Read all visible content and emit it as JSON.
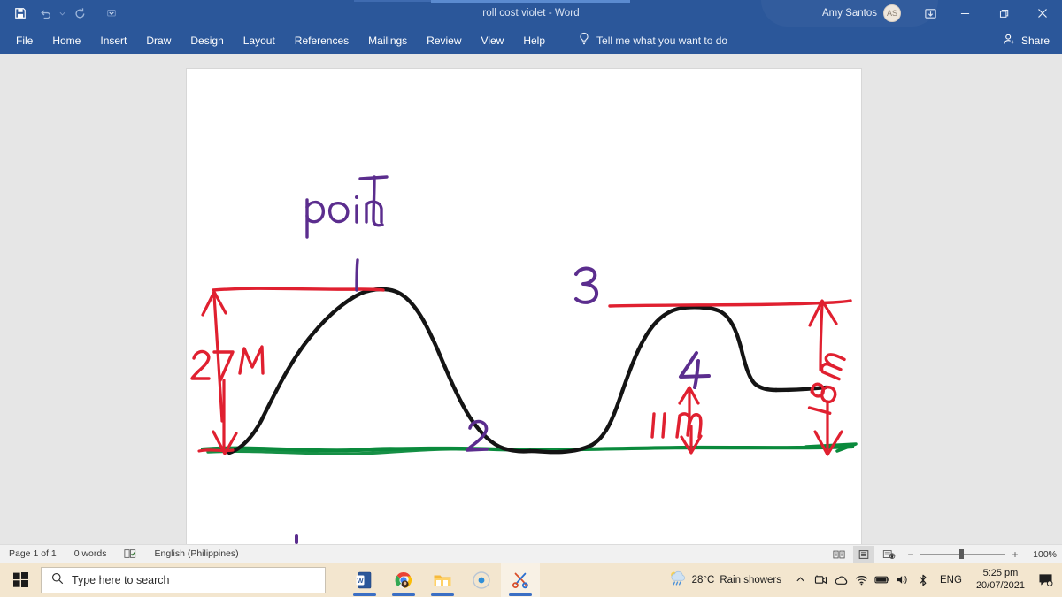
{
  "window": {
    "title": "roll cost violet  -  Word",
    "account_name": "Amy Santos",
    "account_initials": "AS",
    "quick_access": [
      {
        "name": "save-icon",
        "label": "Save"
      },
      {
        "name": "undo-icon",
        "label": "Undo"
      },
      {
        "name": "redo-icon",
        "label": "Redo"
      },
      {
        "name": "customize-quick-access-icon",
        "label": "Customize Quick Access Toolbar"
      }
    ],
    "controls": [
      {
        "name": "ribbon-display-options-button",
        "label": "Ribbon Display Options"
      },
      {
        "name": "minimize-button",
        "label": "Minimize",
        "glyph": "—"
      },
      {
        "name": "restore-button",
        "label": "Restore Down",
        "glyph": "❐"
      },
      {
        "name": "close-button",
        "label": "Close",
        "glyph": "✕"
      }
    ],
    "accent_color": "#2b579a"
  },
  "ribbon": {
    "tabs": [
      {
        "label": "File"
      },
      {
        "label": "Home"
      },
      {
        "label": "Insert"
      },
      {
        "label": "Draw"
      },
      {
        "label": "Design"
      },
      {
        "label": "Layout"
      },
      {
        "label": "References"
      },
      {
        "label": "Mailings"
      },
      {
        "label": "Review"
      },
      {
        "label": "View"
      },
      {
        "label": "Help"
      }
    ],
    "tell_me": "Tell me what you want to do",
    "share_label": "Share"
  },
  "document": {
    "page_background": "#ffffff",
    "ink_colors": {
      "black": "#141414",
      "red": "#e02030",
      "green": "#0a8a3c",
      "purple": "#5b2d8e"
    },
    "annotations": [
      {
        "name": "ink-label-point",
        "text": "point",
        "color": "purple"
      },
      {
        "name": "ink-label-1",
        "text": "1",
        "color": "purple"
      },
      {
        "name": "ink-label-2",
        "text": "2",
        "color": "purple"
      },
      {
        "name": "ink-label-3",
        "text": "3",
        "color": "purple"
      },
      {
        "name": "ink-label-4",
        "text": "4",
        "color": "purple"
      },
      {
        "name": "ink-dimension-27m",
        "text": "27 M",
        "color": "red"
      },
      {
        "name": "ink-dimension-11m",
        "text": "11 m",
        "color": "red"
      },
      {
        "name": "ink-dimension-18m",
        "text": "18 m",
        "color": "red"
      }
    ]
  },
  "status_bar": {
    "page_info": "Page 1 of 1",
    "word_count": "0 words",
    "proofing_icon": "proofing-errors-icon",
    "language": "English (Philippines)",
    "views": [
      {
        "name": "read-mode-view-button",
        "label": "Read Mode",
        "active": false
      },
      {
        "name": "print-layout-view-button",
        "label": "Print Layout",
        "active": true
      },
      {
        "name": "web-layout-view-button",
        "label": "Web Layout",
        "active": false
      }
    ],
    "zoom_out_label": "−",
    "zoom_in_label": "+",
    "zoom_level": "100%"
  },
  "taskbar": {
    "start_label": "Start",
    "search_placeholder": "Type here to search",
    "apps": [
      {
        "name": "taskbar-word-icon",
        "label": "Word",
        "running": true
      },
      {
        "name": "taskbar-chrome-icon",
        "label": "Google Chrome",
        "running": true
      },
      {
        "name": "taskbar-file-explorer-icon",
        "label": "File Explorer",
        "running": true
      },
      {
        "name": "taskbar-media-icon",
        "label": "Media Player",
        "running": false
      },
      {
        "name": "taskbar-snip-sketch-icon",
        "label": "Snip & Sketch",
        "running": true
      }
    ],
    "weather": {
      "temperature": "28°C",
      "condition": "Rain showers",
      "icon": "rain-showers-icon"
    },
    "tray_icons": [
      {
        "name": "show-hidden-icons-chevron-icon",
        "label": "Show hidden icons"
      },
      {
        "name": "webcam-icon",
        "label": "Camera"
      },
      {
        "name": "onedrive-cloud-icon",
        "label": "OneDrive"
      },
      {
        "name": "wifi-icon",
        "label": "Network"
      },
      {
        "name": "battery-icon",
        "label": "Battery"
      },
      {
        "name": "volume-icon",
        "label": "Speakers"
      },
      {
        "name": "bluetooth-icon",
        "label": "Bluetooth"
      }
    ],
    "language": "ENG",
    "time": "5:25 pm",
    "date": "20/07/2021",
    "notifications_icon": "action-center-icon"
  }
}
